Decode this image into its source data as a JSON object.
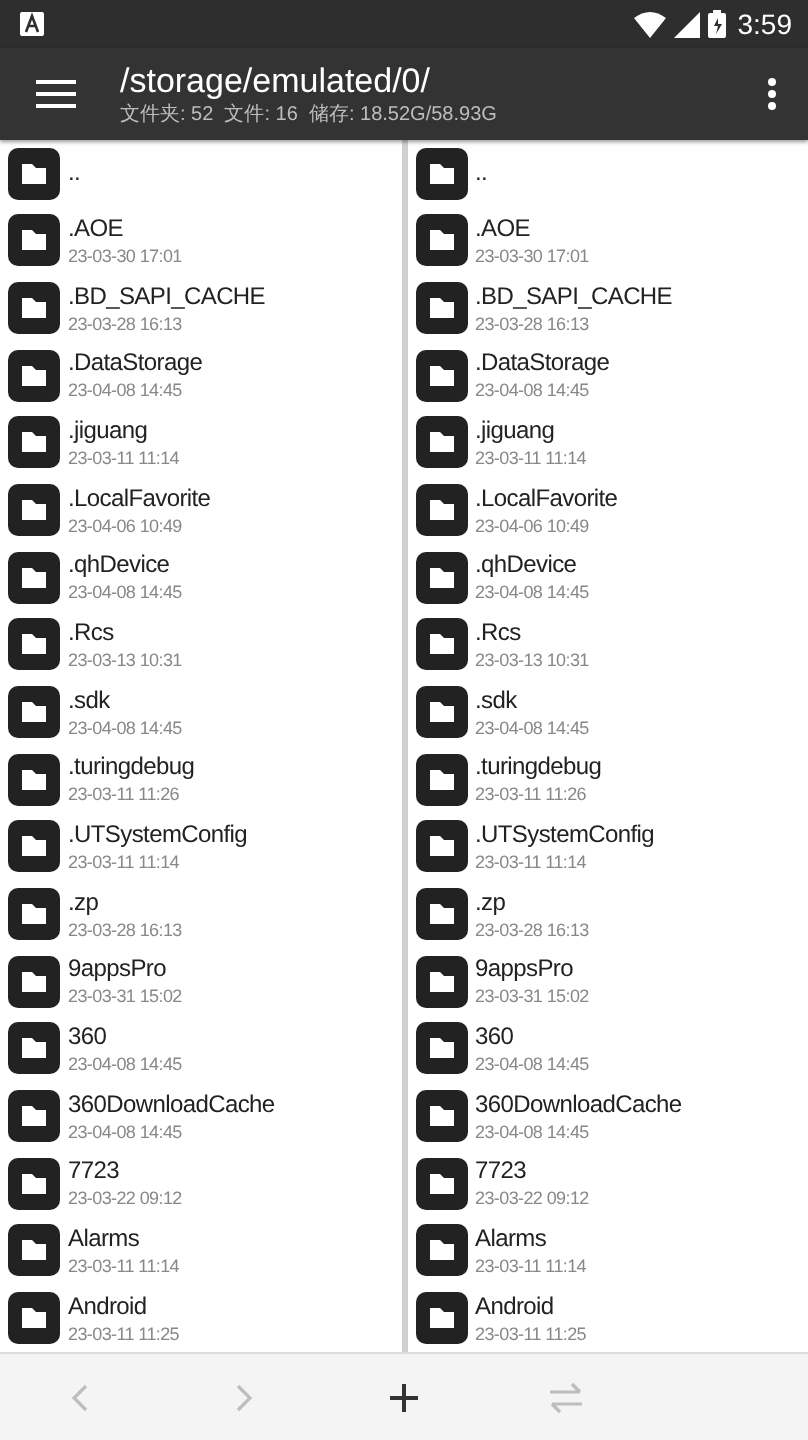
{
  "status_bar": {
    "time": "3:59"
  },
  "toolbar": {
    "title": "/storage/emulated/0/",
    "subtitle": "文件夹: 52  文件: 16  储存: 18.52G/58.93G"
  },
  "panes": [
    {
      "items": [
        {
          "name": ".."
        },
        {
          "name": ".AOE",
          "date": "23-03-30 17:01"
        },
        {
          "name": ".BD_SAPI_CACHE",
          "date": "23-03-28 16:13"
        },
        {
          "name": ".DataStorage",
          "date": "23-04-08 14:45"
        },
        {
          "name": ".jiguang",
          "date": "23-03-11 11:14"
        },
        {
          "name": ".LocalFavorite",
          "date": "23-04-06 10:49"
        },
        {
          "name": ".qhDevice",
          "date": "23-04-08 14:45"
        },
        {
          "name": ".Rcs",
          "date": "23-03-13 10:31"
        },
        {
          "name": ".sdk",
          "date": "23-04-08 14:45"
        },
        {
          "name": ".turingdebug",
          "date": "23-03-11 11:26"
        },
        {
          "name": ".UTSystemConfig",
          "date": "23-03-11 11:14"
        },
        {
          "name": ".zp",
          "date": "23-03-28 16:13"
        },
        {
          "name": "9appsPro",
          "date": "23-03-31 15:02"
        },
        {
          "name": "360",
          "date": "23-04-08 14:45"
        },
        {
          "name": "360DownloadCache",
          "date": "23-04-08 14:45"
        },
        {
          "name": "7723",
          "date": "23-03-22 09:12"
        },
        {
          "name": "Alarms",
          "date": "23-03-11 11:14"
        },
        {
          "name": "Android",
          "date": "23-03-11 11:25"
        }
      ]
    },
    {
      "items": [
        {
          "name": ".."
        },
        {
          "name": ".AOE",
          "date": "23-03-30 17:01"
        },
        {
          "name": ".BD_SAPI_CACHE",
          "date": "23-03-28 16:13"
        },
        {
          "name": ".DataStorage",
          "date": "23-04-08 14:45"
        },
        {
          "name": ".jiguang",
          "date": "23-03-11 11:14"
        },
        {
          "name": ".LocalFavorite",
          "date": "23-04-06 10:49"
        },
        {
          "name": ".qhDevice",
          "date": "23-04-08 14:45"
        },
        {
          "name": ".Rcs",
          "date": "23-03-13 10:31"
        },
        {
          "name": ".sdk",
          "date": "23-04-08 14:45"
        },
        {
          "name": ".turingdebug",
          "date": "23-03-11 11:26"
        },
        {
          "name": ".UTSystemConfig",
          "date": "23-03-11 11:14"
        },
        {
          "name": ".zp",
          "date": "23-03-28 16:13"
        },
        {
          "name": "9appsPro",
          "date": "23-03-31 15:02"
        },
        {
          "name": "360",
          "date": "23-04-08 14:45"
        },
        {
          "name": "360DownloadCache",
          "date": "23-04-08 14:45"
        },
        {
          "name": "7723",
          "date": "23-03-22 09:12"
        },
        {
          "name": "Alarms",
          "date": "23-03-11 11:14"
        },
        {
          "name": "Android",
          "date": "23-03-11 11:25"
        }
      ]
    }
  ],
  "bottom_bar": [
    {
      "kind": "back",
      "disabled": true
    },
    {
      "kind": "forward",
      "disabled": true
    },
    {
      "kind": "add",
      "disabled": false
    },
    {
      "kind": "swap",
      "disabled": true
    }
  ]
}
